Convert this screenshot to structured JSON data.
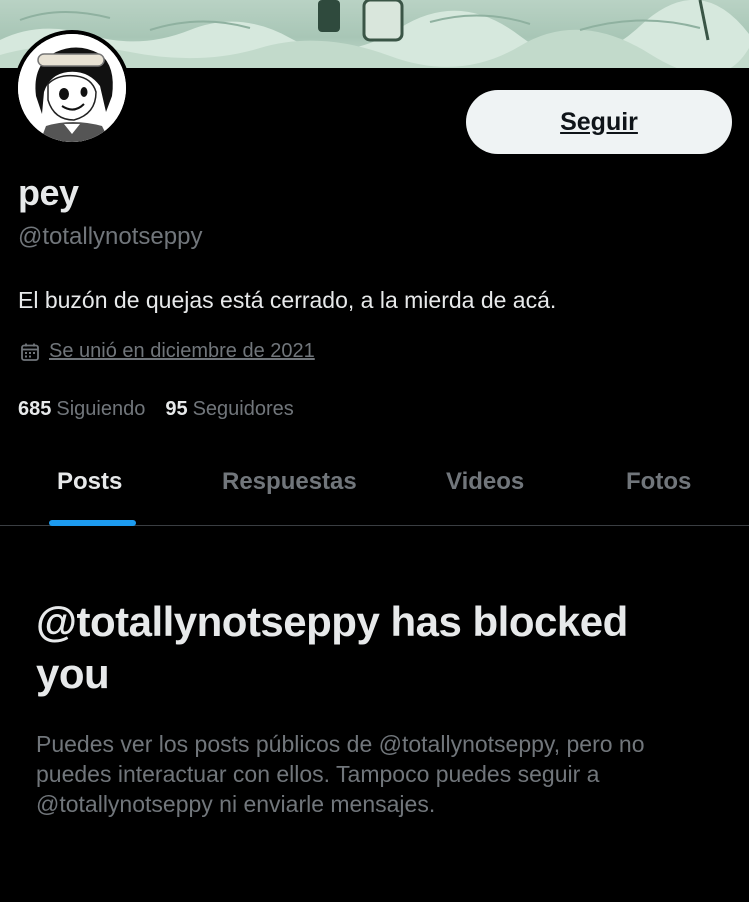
{
  "profile": {
    "display_name": "pey",
    "handle": "@totallynotseppy",
    "bio": "El buzón de quejas está cerrado, a la mierda de acá.",
    "joined": "Se unió en diciembre de 2021",
    "following_count": "685",
    "following_label": "Siguiendo",
    "followers_count": "95",
    "followers_label": "Seguidores"
  },
  "actions": {
    "follow_label": "Seguir"
  },
  "tabs": [
    {
      "label": "Posts",
      "active": true
    },
    {
      "label": "Respuestas",
      "active": false
    },
    {
      "label": "Videos",
      "active": false
    },
    {
      "label": "Fotos",
      "active": false
    }
  ],
  "blocked": {
    "title": "@totallynotseppy has blocked you",
    "description": "Puedes ver los posts públicos de @totallynotseppy, pero no puedes interactuar con ellos. Tampoco puedes seguir a @totallynotseppy ni enviarle mensajes."
  },
  "colors": {
    "background": "#000000",
    "text_primary": "#e7e9ea",
    "text_secondary": "#71767b",
    "accent": "#1d9bf0",
    "button_bg": "#eff3f4"
  },
  "icons": {
    "joined": "calendar-icon"
  }
}
